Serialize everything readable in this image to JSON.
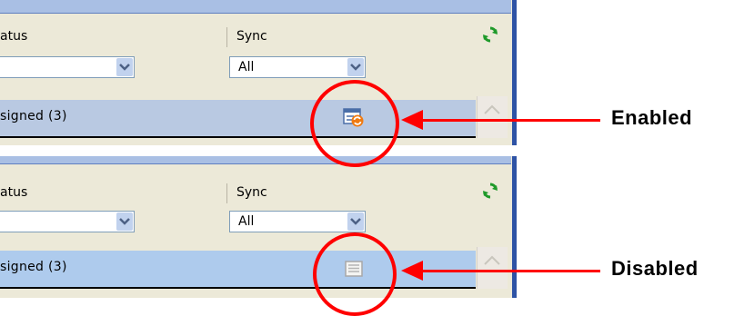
{
  "panels": [
    {
      "state": "enabled",
      "header": {
        "col1_label": "atus",
        "col2_label": "Sync"
      },
      "filter": {
        "left_value": "",
        "right_value": "All"
      },
      "row": {
        "label": "signed (3)"
      }
    },
    {
      "state": "disabled",
      "header": {
        "col1_label": "atus",
        "col2_label": "Sync"
      },
      "filter": {
        "left_value": "",
        "right_value": "All"
      },
      "row": {
        "label": "signed (3)"
      }
    }
  ],
  "callouts": {
    "enabled_label": "Enabled",
    "disabled_label": "Disabled"
  },
  "icons": {
    "header_sync": "refresh-icon",
    "dropdown": "chevron-down-icon",
    "row_enabled": "sync-enabled-icon",
    "row_disabled": "sync-disabled-icon",
    "scroll_up": "scroll-up-arrow-icon"
  },
  "colors": {
    "annotation": "#ff0000",
    "accent_blue": "#2e53a5",
    "sync_green": "#1f9a2a",
    "sync_orange": "#f07a10"
  }
}
